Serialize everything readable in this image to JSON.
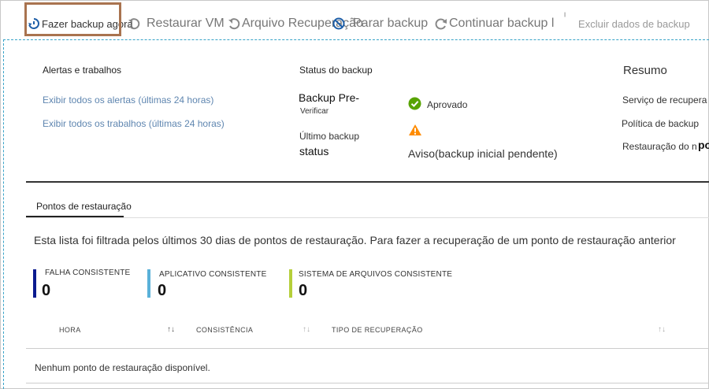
{
  "toolbar": {
    "backup_now": "Fazer backup agora",
    "restore_vm": "Restaurar VM",
    "file_recovery": "Arquivo Recuperação",
    "stop_backup": "Parar backup",
    "resume_backup": "Continuar backup l",
    "delete_backup_data": "Excluir dados de backup"
  },
  "alerts": {
    "title": "Alertas e trabalhos",
    "view_alerts": "Exibir todos os alertas (últimas 24 horas)",
    "view_jobs": "Exibir todos os trabalhos (últimas 24 horas)"
  },
  "backup_status": {
    "title": "Status do backup",
    "precheck_label": "Backup Pre-",
    "precheck_sub": "Verificar",
    "precheck_value": "Aprovado",
    "last_backup_label": "Último backup",
    "last_backup_sub": "status",
    "last_backup_value": "Aviso(backup inicial pendente)"
  },
  "summary": {
    "title": "Resumo",
    "items": [
      "Serviço de recupera",
      "Política de backup",
      "Restauração do n"
    ],
    "tail": "po"
  },
  "tabs": {
    "restore_points": "Pontos de restauração"
  },
  "info_text": "Esta lista foi filtrada pelos últimos 30 dias de pontos de restauração. Para fazer a recuperação de um ponto de restauração anterior",
  "counters": [
    {
      "label": "FALHA CONSISTENTE",
      "value": "0",
      "color": "#0b1b8f"
    },
    {
      "label": "APLICATIVO CONSISTENTE",
      "value": "0",
      "color": "#5ab1d9"
    },
    {
      "label": "SISTEMA DE ARQUIVOS CONSISTENTE",
      "value": "0",
      "color": "#b5cf3a"
    }
  ],
  "table": {
    "columns": [
      "HORA",
      "CONSISTÊNCIA",
      "TIPO DE RECUPERAÇÃO"
    ],
    "empty_message": "Nenhum ponto de restauração disponível."
  },
  "colors": {
    "approved": "#57a300",
    "warning": "#ff8c00",
    "accent": "#0078d4",
    "highlight": "#a9734f"
  }
}
